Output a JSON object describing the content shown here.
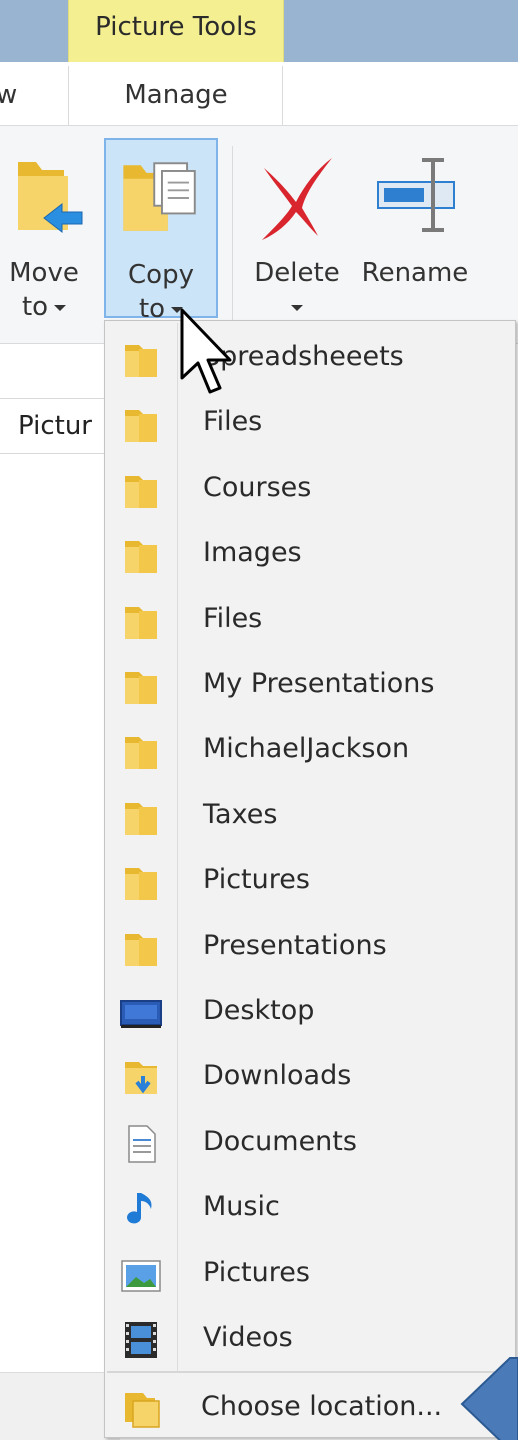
{
  "titlebar": {
    "context_tab": "Picture Tools"
  },
  "tabs": {
    "partial_left": "w",
    "manage": "Manage"
  },
  "ribbon": {
    "move_line1": "Move",
    "move_line2": "to",
    "copy_line1": "Copy",
    "copy_line2": "to",
    "delete_label": "Delete",
    "rename_label": "Rename"
  },
  "address": {
    "partial_path": "Pictur"
  },
  "copy_menu": {
    "items": [
      {
        "label": "Spreadsheeets",
        "icon": "folder-icon"
      },
      {
        "label": "Files",
        "icon": "folder-icon"
      },
      {
        "label": "Courses",
        "icon": "folder-icon"
      },
      {
        "label": "Images",
        "icon": "folder-icon"
      },
      {
        "label": "Files",
        "icon": "folder-icon"
      },
      {
        "label": "My Presentations",
        "icon": "folder-icon"
      },
      {
        "label": "MichaelJackson",
        "icon": "folder-icon"
      },
      {
        "label": "Taxes",
        "icon": "folder-icon"
      },
      {
        "label": "Pictures",
        "icon": "folder-icon"
      },
      {
        "label": "Presentations",
        "icon": "folder-icon"
      },
      {
        "label": "Desktop",
        "icon": "desktop-icon"
      },
      {
        "label": "Downloads",
        "icon": "downloads-icon"
      },
      {
        "label": "Documents",
        "icon": "documents-icon"
      },
      {
        "label": "Music",
        "icon": "music-icon"
      },
      {
        "label": "Pictures",
        "icon": "pictures-icon"
      },
      {
        "label": "Videos",
        "icon": "videos-icon"
      }
    ],
    "choose_location": "Choose location..."
  },
  "colors": {
    "titlebar": "#99b4d1",
    "context_tab": "#f4f092",
    "selected_button": "#cce4f7",
    "callout_arrow": "#4a7ab8"
  }
}
